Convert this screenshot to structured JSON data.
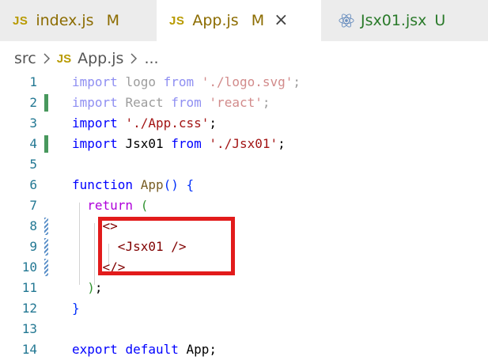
{
  "tabs": [
    {
      "icon": "JS",
      "name": "index.js",
      "status": "M"
    },
    {
      "icon": "JS",
      "name": "App.js",
      "status": "M",
      "close": "×"
    },
    {
      "icon": "react-icon",
      "name": "Jsx01.jsx",
      "status": "U"
    }
  ],
  "breadcrumb": {
    "folder": "src",
    "file_icon": "JS",
    "file": "App.js",
    "more": "..."
  },
  "code": {
    "line_numbers": [
      "1",
      "2",
      "3",
      "4",
      "5",
      "6",
      "7",
      "8",
      "9",
      "10",
      "11",
      "12",
      "13",
      "14"
    ],
    "l1": {
      "kw": "import",
      "id": "logo",
      "from": "from",
      "str": "'./logo.svg'",
      "semi": ";"
    },
    "l2": {
      "kw": "import",
      "id": "React",
      "from": "from",
      "str": "'react'",
      "semi": ";"
    },
    "l3": {
      "kw": "import",
      "str": "'./App.css'",
      "semi": ";"
    },
    "l4": {
      "kw": "import",
      "id": "Jsx01",
      "from": "from",
      "str": "'./Jsx01'",
      "semi": ";"
    },
    "l6": {
      "kw": "function",
      "fn": "App",
      "parens": "()",
      "brace": "{"
    },
    "l7": {
      "kw": "return",
      "paren": "("
    },
    "l8": {
      "tag": "<>"
    },
    "l9": {
      "open": "<",
      "tag": "Jsx01",
      "close": "/>"
    },
    "l10": {
      "tag": "</>"
    },
    "l11": {
      "paren": ")",
      "semi": ";"
    },
    "l12": {
      "brace": "}"
    },
    "l14": {
      "kw1": "export",
      "kw2": "default",
      "id": "App",
      "semi": ";"
    }
  },
  "colors": {
    "highlight_box": "#e21b1b",
    "added": "#48985d",
    "modified": "#5a8fc8"
  }
}
